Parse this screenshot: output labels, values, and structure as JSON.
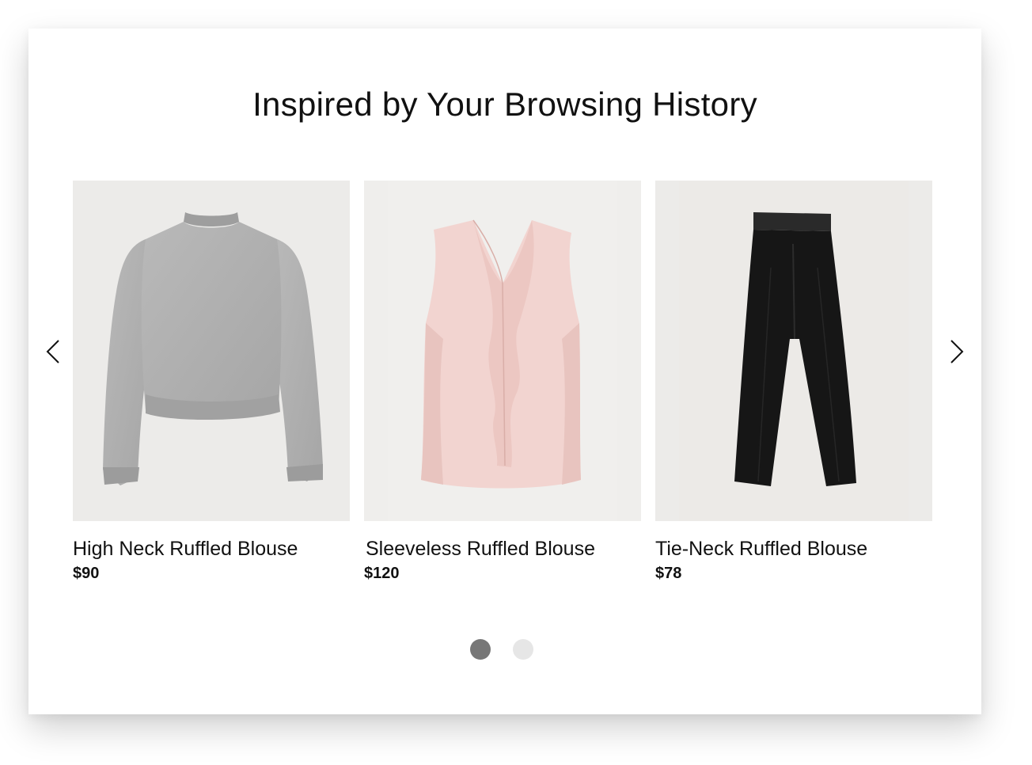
{
  "section": {
    "title": "Inspired by Your Browsing History"
  },
  "carousel": {
    "prev_icon": "chevron-left-icon",
    "next_icon": "chevron-right-icon",
    "active_page": 1,
    "page_count": 2,
    "colors": {
      "dot_active": "#777777",
      "dot_inactive": "#e6e6e6"
    }
  },
  "products": [
    {
      "name": "High Neck Ruffled Blouse",
      "price": "$90",
      "image": "grey-sweater-image"
    },
    {
      "name": "Sleeveless Ruffled Blouse",
      "price": "$120",
      "image": "pink-ruffle-top-image"
    },
    {
      "name": "Tie-Neck Ruffled Blouse",
      "price": "$78",
      "image": "black-trousers-image"
    }
  ]
}
